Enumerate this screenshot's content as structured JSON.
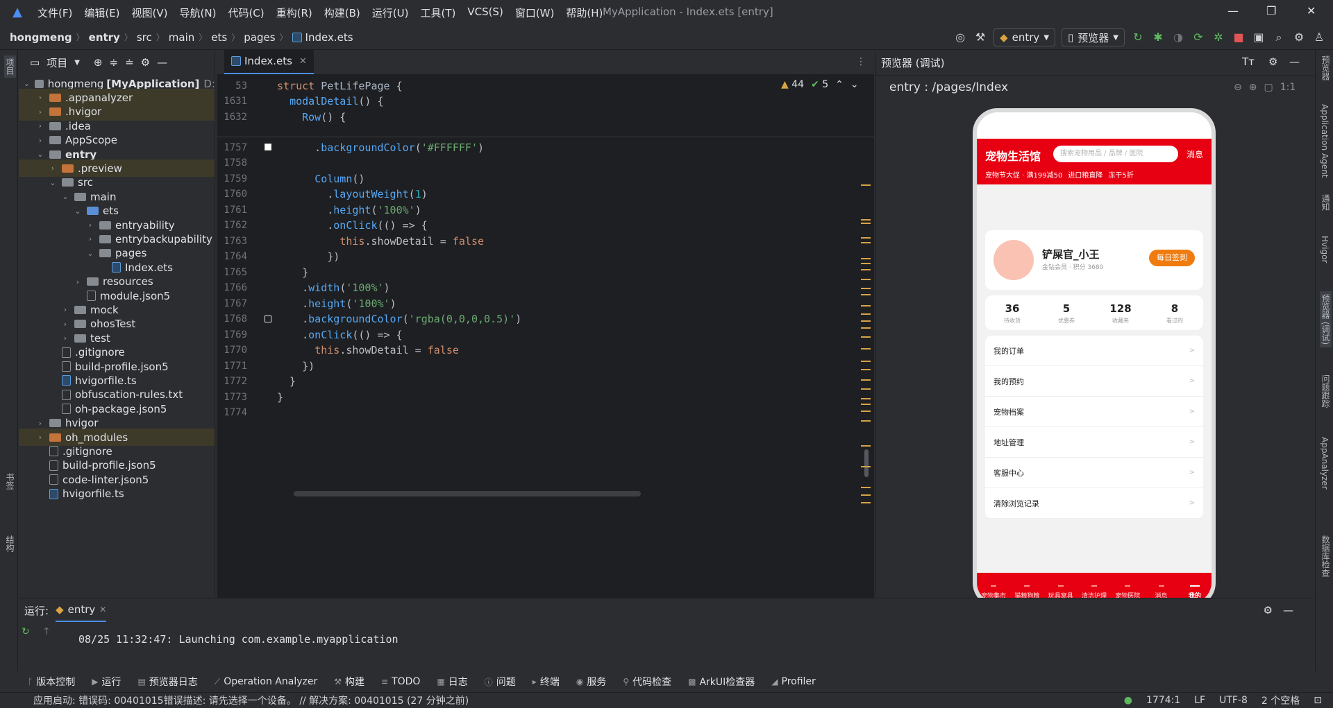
{
  "menu": [
    "文件(F)",
    "编辑(E)",
    "视图(V)",
    "导航(N)",
    "代码(C)",
    "重构(R)",
    "构建(B)",
    "运行(U)",
    "工具(T)",
    "VCS(S)",
    "窗口(W)",
    "帮助(H)"
  ],
  "window_title": "MyApplication - Index.ets [entry]",
  "breadcrumb": [
    "hongmeng",
    "entry",
    "src",
    "main",
    "ets",
    "pages",
    "Index.ets"
  ],
  "run_config": "entry",
  "device": "预览器",
  "project_panel": {
    "title": "项目",
    "tree": [
      {
        "label": "hongmeng",
        "bold": "[MyApplication]",
        "extra": "D:",
        "indent": 0,
        "chev": "v",
        "icon": "folder"
      },
      {
        "label": ".appanalyzer",
        "indent": 1,
        "chev": ">",
        "icon": "orange",
        "hl": true
      },
      {
        "label": ".hvigor",
        "indent": 1,
        "chev": ">",
        "icon": "orange",
        "hl": true
      },
      {
        "label": ".idea",
        "indent": 1,
        "chev": ">",
        "icon": "folder"
      },
      {
        "label": "AppScope",
        "indent": 1,
        "chev": ">",
        "icon": "folder"
      },
      {
        "label": "entry",
        "indent": 1,
        "chev": "v",
        "icon": "folder",
        "bold_label": true
      },
      {
        "label": ".preview",
        "indent": 2,
        "chev": ">",
        "icon": "orange",
        "hl": true
      },
      {
        "label": "src",
        "indent": 2,
        "chev": "v",
        "icon": "folder"
      },
      {
        "label": "main",
        "indent": 3,
        "chev": "v",
        "icon": "folder"
      },
      {
        "label": "ets",
        "indent": 4,
        "chev": "v",
        "icon": "blue"
      },
      {
        "label": "entryability",
        "indent": 5,
        "chev": ">",
        "icon": "folder"
      },
      {
        "label": "entrybackupability",
        "indent": 5,
        "chev": ">",
        "icon": "folder"
      },
      {
        "label": "pages",
        "indent": 5,
        "chev": "v",
        "icon": "folder"
      },
      {
        "label": "Index.ets",
        "indent": 6,
        "chev": "",
        "icon": "ts"
      },
      {
        "label": "resources",
        "indent": 4,
        "chev": ">",
        "icon": "folder"
      },
      {
        "label": "module.json5",
        "indent": 4,
        "chev": "",
        "icon": "file"
      },
      {
        "label": "mock",
        "indent": 3,
        "chev": ">",
        "icon": "folder"
      },
      {
        "label": "ohosTest",
        "indent": 3,
        "chev": ">",
        "icon": "folder"
      },
      {
        "label": "test",
        "indent": 3,
        "chev": ">",
        "icon": "folder"
      },
      {
        "label": ".gitignore",
        "indent": 2,
        "chev": "",
        "icon": "file"
      },
      {
        "label": "build-profile.json5",
        "indent": 2,
        "chev": "",
        "icon": "file"
      },
      {
        "label": "hvigorfile.ts",
        "indent": 2,
        "chev": "",
        "icon": "ts"
      },
      {
        "label": "obfuscation-rules.txt",
        "indent": 2,
        "chev": "",
        "icon": "file"
      },
      {
        "label": "oh-package.json5",
        "indent": 2,
        "chev": "",
        "icon": "file"
      },
      {
        "label": "hvigor",
        "indent": 1,
        "chev": ">",
        "icon": "folder"
      },
      {
        "label": "oh_modules",
        "indent": 1,
        "chev": ">",
        "icon": "orange",
        "hl": true
      },
      {
        "label": ".gitignore",
        "indent": 1,
        "chev": "",
        "icon": "file"
      },
      {
        "label": "build-profile.json5",
        "indent": 1,
        "chev": "",
        "icon": "file"
      },
      {
        "label": "code-linter.json5",
        "indent": 1,
        "chev": "",
        "icon": "file"
      },
      {
        "label": "hvigorfile.ts",
        "indent": 1,
        "chev": "",
        "icon": "ts"
      }
    ]
  },
  "editor": {
    "tab": "Index.ets",
    "warnings": "44",
    "checks": "5",
    "sticky": [
      {
        "ln": "53",
        "html": "<span class='kw'>struct</span> <span class='cls'>PetLifePage</span> {"
      },
      {
        "ln": "1631",
        "html": "  <span class='fn'>modalDetail</span>() {"
      },
      {
        "ln": "1632",
        "html": "    <span class='fn'>Row</span>() {"
      }
    ],
    "lines": [
      {
        "ln": "1757",
        "html": "      .<span class='meth'>backgroundColor</span>(<span class='str'>'#FFFFFF'</span>)",
        "box": true
      },
      {
        "ln": "1758",
        "html": ""
      },
      {
        "ln": "1759",
        "html": "      <span class='fn'>Column</span>()"
      },
      {
        "ln": "1760",
        "html": "        .<span class='meth'>layoutWeight</span>(<span class='num'>1</span>)"
      },
      {
        "ln": "1761",
        "html": "        .<span class='meth'>height</span>(<span class='str'>'100%'</span>)"
      },
      {
        "ln": "1762",
        "html": "        .<span class='meth'>onClick</span>(() => {"
      },
      {
        "ln": "1763",
        "html": "          <span class='this'>this</span>.showDetail = <span class='kw'>false</span>"
      },
      {
        "ln": "1764",
        "html": "        })"
      },
      {
        "ln": "1765",
        "html": "    }"
      },
      {
        "ln": "1766",
        "html": "    .<span class='meth'>width</span>(<span class='str'>'100%'</span>)"
      },
      {
        "ln": "1767",
        "html": "    .<span class='meth'>height</span>(<span class='str'>'100%'</span>)"
      },
      {
        "ln": "1768",
        "html": "    .<span class='meth'>backgroundColor</span>(<span class='str'>'rgba(0,0,0,0.5)'</span>)",
        "box": true
      },
      {
        "ln": "1769",
        "html": "    .<span class='meth'>onClick</span>(() => {"
      },
      {
        "ln": "1770",
        "html": "      <span class='this'>this</span>.showDetail = <span class='kw'>false</span>"
      },
      {
        "ln": "1771",
        "html": "    })"
      },
      {
        "ln": "1772",
        "html": "  }"
      },
      {
        "ln": "1773",
        "html": "}"
      },
      {
        "ln": "1774",
        "html": ""
      }
    ]
  },
  "preview": {
    "title": "预览器 (调试)",
    "path": "entry : /pages/Index",
    "app": {
      "brand": "宠物生活馆",
      "search_placeholder": "搜索宠物用品 / 品牌 / 医院",
      "message": "消息",
      "promos": [
        "宠物节大促 · 满199减50",
        "进口粮直降",
        "冻干5折"
      ],
      "user": {
        "name": "铲屎官_小王",
        "sub": "金钻会员 · 积分 3680",
        "sign": "每日签到"
      },
      "stats": [
        {
          "v": "36",
          "l": "待收货"
        },
        {
          "v": "5",
          "l": "优惠券"
        },
        {
          "v": "128",
          "l": "收藏夹"
        },
        {
          "v": "8",
          "l": "看过的"
        }
      ],
      "menu": [
        "我的订单",
        "我的预约",
        "宠物档案",
        "地址管理",
        "客服中心",
        "清除浏览记录"
      ],
      "tabs": [
        "宠物集市",
        "猫粮狗粮",
        "玩具窝具",
        "清洁护理",
        "宠物医院",
        "消息",
        "我的"
      ],
      "active_tab": 6
    }
  },
  "run_panel": {
    "label": "运行:",
    "tab": "entry",
    "output": "08/25 11:32:47: Launching com.example.myapplication"
  },
  "tool_tabs": [
    "版本控制",
    "运行",
    "预览器日志",
    "Operation Analyzer",
    "构建",
    "TODO",
    "日志",
    "问题",
    "终端",
    "服务",
    "代码检查",
    "ArkUI检查器",
    "Profiler"
  ],
  "status": {
    "message": "应用启动: 错误码: 00401015错误描述: 请先选择一个设备。 // 解决方案: 00401015 (27 分钟之前)",
    "position": "1774:1",
    "line_sep": "LF",
    "encoding": "UTF-8",
    "indent": "2 个空格"
  },
  "right_stripe": [
    "预览器",
    "Application Agent",
    "通知",
    "Hvigor",
    "预览器 (调试)",
    "问题跟踪",
    "AppAnalyzer",
    "数据库检查"
  ],
  "left_stripe": [
    "项目",
    "书签",
    "结构"
  ]
}
